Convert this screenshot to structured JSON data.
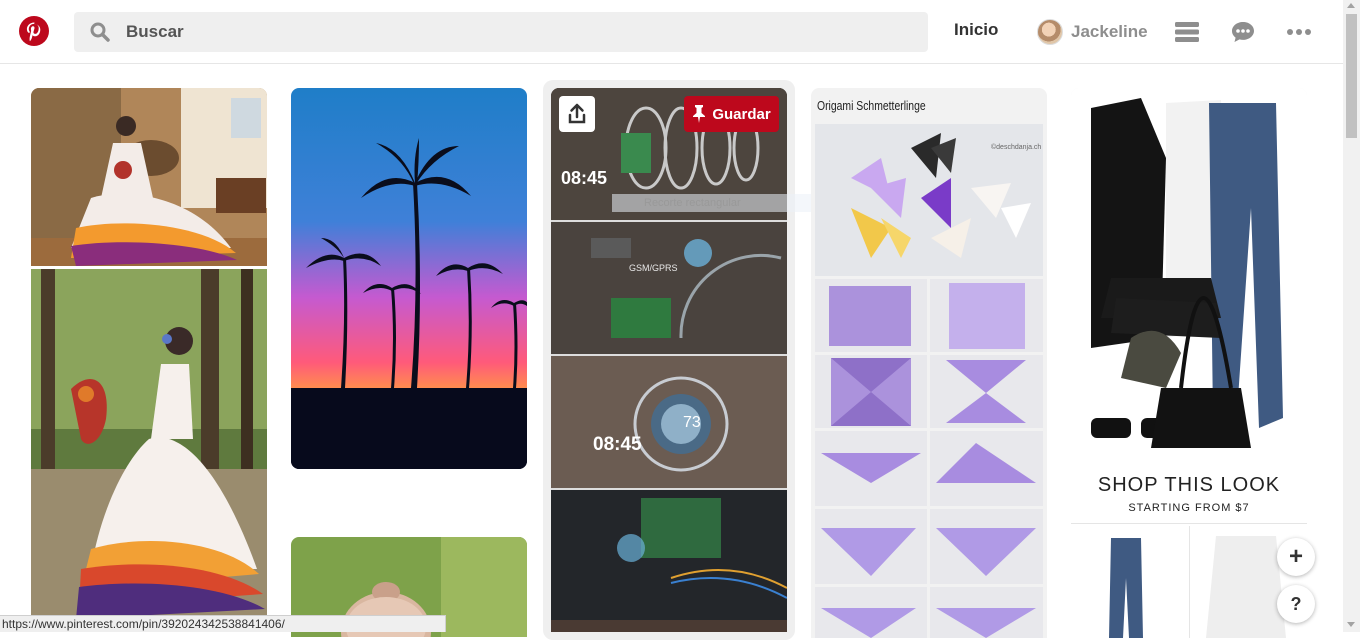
{
  "header": {
    "logo_icon": "pinterest-logo-icon",
    "search_placeholder": "Buscar",
    "home_label": "Inicio",
    "user_name": "Jackeline",
    "icons": [
      "search-icon",
      "menu-icon",
      "messages-icon",
      "more-icon"
    ],
    "brand_color": "#bd081c"
  },
  "pins": {
    "tech_pin": {
      "save_label": "Guardar",
      "share_icon": "share-icon",
      "clock_text": "08:45",
      "clock_text_2": "08:45",
      "module_text": "GSM/GPRS",
      "dial_text": "73",
      "tooltip": "Recorte rectangular"
    },
    "origami_pin": {
      "title": "Origami Schmetterlinge",
      "watermark": "©deschdanja.ch"
    },
    "fashion_pin": {
      "shop_title": "SHOP THIS LOOK",
      "shop_subtitle": "STARTING FROM $7"
    }
  },
  "floating": {
    "add_label": "+",
    "help_label": "?"
  },
  "status_bar": {
    "url": "https://www.pinterest.com/pin/392024342538841406/"
  }
}
